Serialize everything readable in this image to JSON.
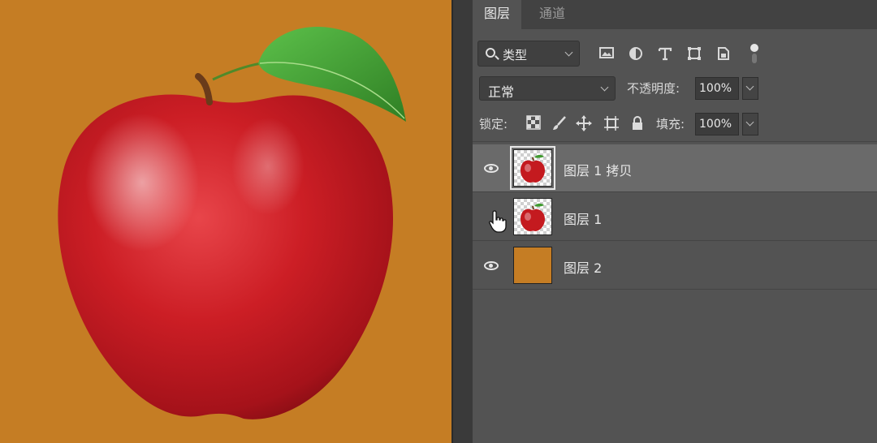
{
  "tabs": [
    {
      "label": "图层",
      "active": true
    },
    {
      "label": "通道",
      "active": false
    }
  ],
  "filter": {
    "kind_label": "类型",
    "icons": [
      "image-filter-icon",
      "adjustment-filter-icon",
      "type-filter-icon",
      "shape-filter-icon",
      "smart-object-filter-icon",
      "filter-toggle-icon"
    ]
  },
  "blend": {
    "mode_label": "正常",
    "opacity_label": "不透明度:",
    "opacity_value": "100%"
  },
  "lock": {
    "label": "锁定:",
    "icons": [
      "lock-transparent-pixels-icon",
      "lock-image-pixels-icon",
      "lock-position-icon",
      "lock-artboard-icon",
      "lock-all-icon"
    ],
    "fill_label": "填充:",
    "fill_value": "100%"
  },
  "layers": [
    {
      "name": "图层 1 拷贝",
      "visible": true,
      "selected": true,
      "thumb": "apple"
    },
    {
      "name": "图层 1",
      "visible": false,
      "selected": false,
      "thumb": "apple"
    },
    {
      "name": "图层 2",
      "visible": true,
      "selected": false,
      "thumb": "solid"
    }
  ],
  "colors": {
    "canvas_bg": "#c57d24",
    "apple_red": "#c41a1f",
    "leaf_green": "#3f9a2e",
    "panel_bg": "#535353",
    "selected_row": "#6a6a6a"
  }
}
